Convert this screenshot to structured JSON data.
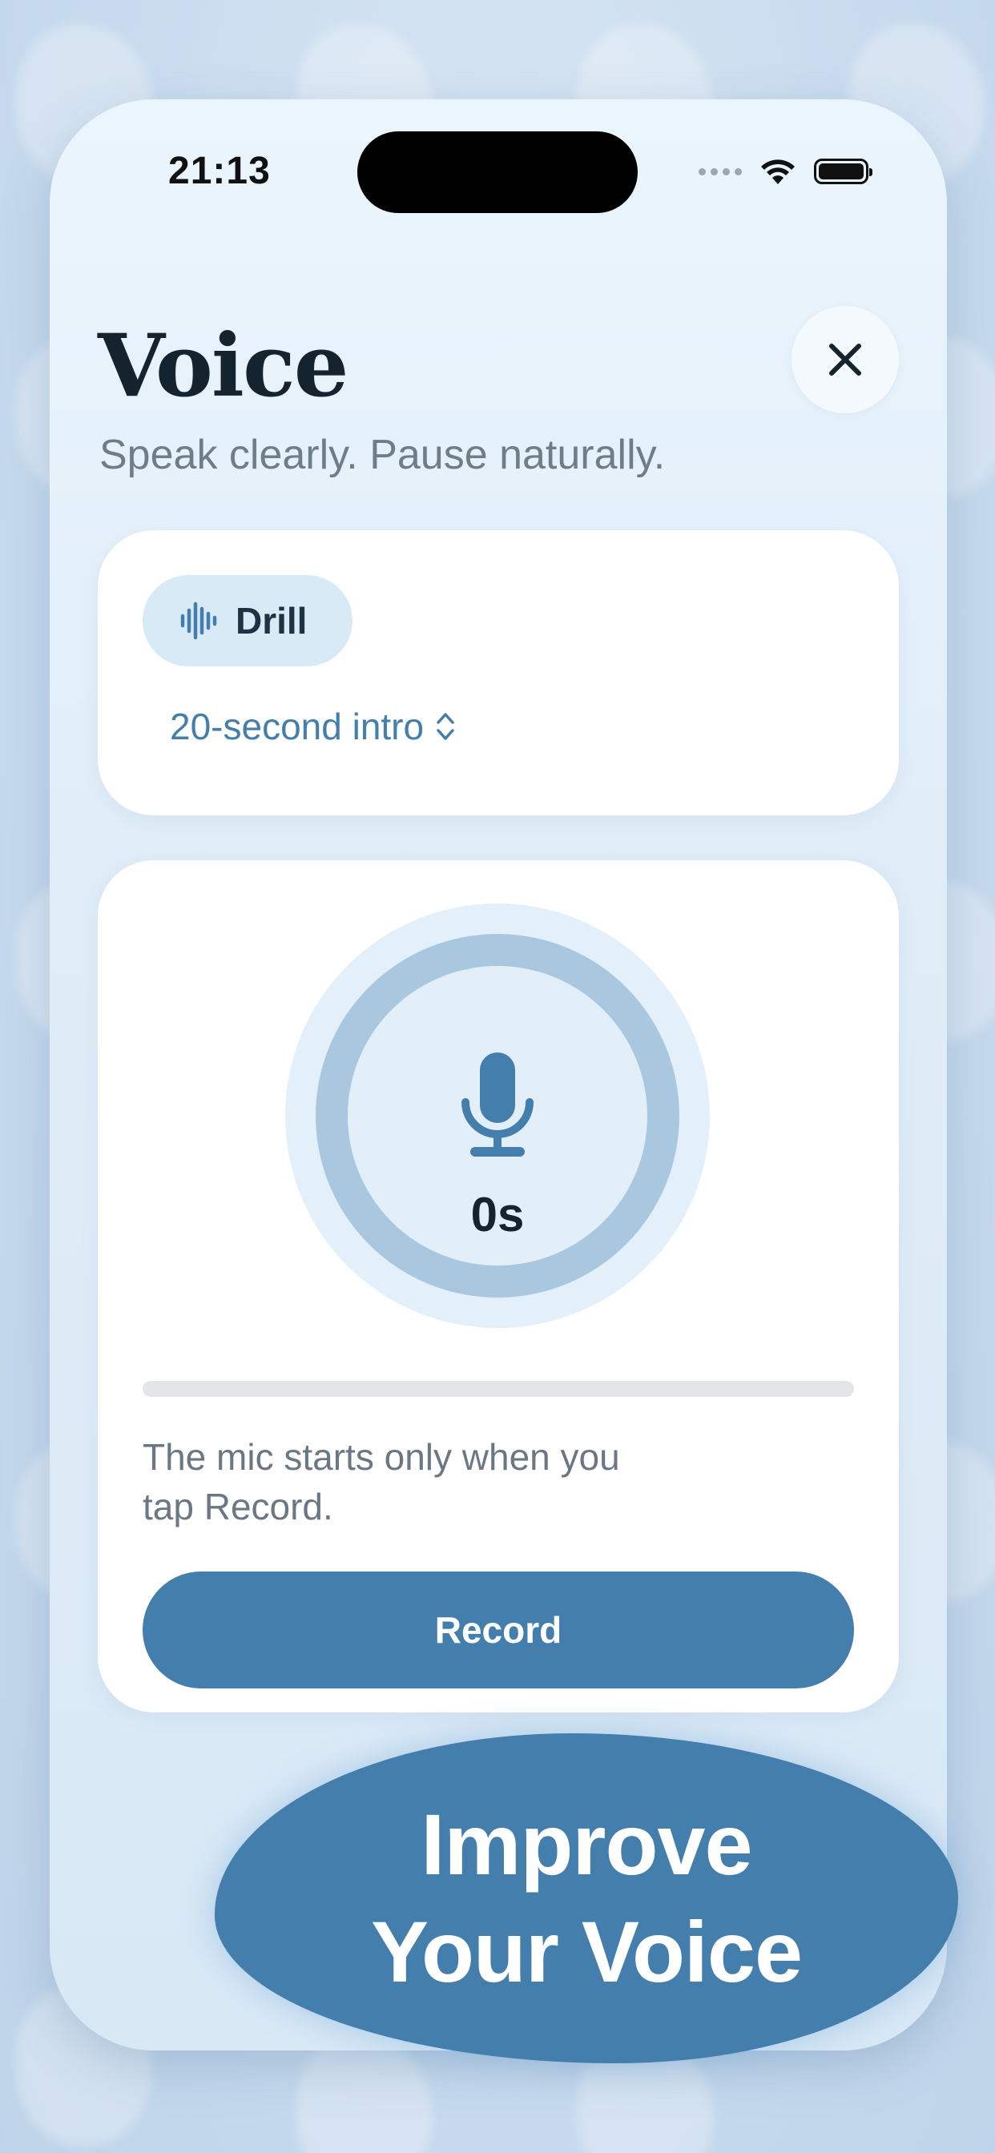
{
  "status_bar": {
    "time": "21:13"
  },
  "header": {
    "title": "Voice",
    "subtitle": "Speak clearly. Pause naturally."
  },
  "drill": {
    "chip_label": "Drill",
    "selected_option": "20-second intro"
  },
  "recorder": {
    "timer": "0s",
    "progress": 0,
    "note_line1": "The mic starts only when you",
    "note_line2": "tap Record.",
    "record_label": "Record"
  },
  "promo": {
    "line1": "Improve",
    "line2": "Your Voice"
  },
  "colors": {
    "accent": "#447ead",
    "title": "#15232f",
    "muted": "#6e7d88"
  },
  "icons": [
    "close-icon",
    "waveform-icon",
    "chevron-updown-icon",
    "microphone-icon",
    "wifi-icon",
    "battery-icon",
    "signal-icon"
  ]
}
